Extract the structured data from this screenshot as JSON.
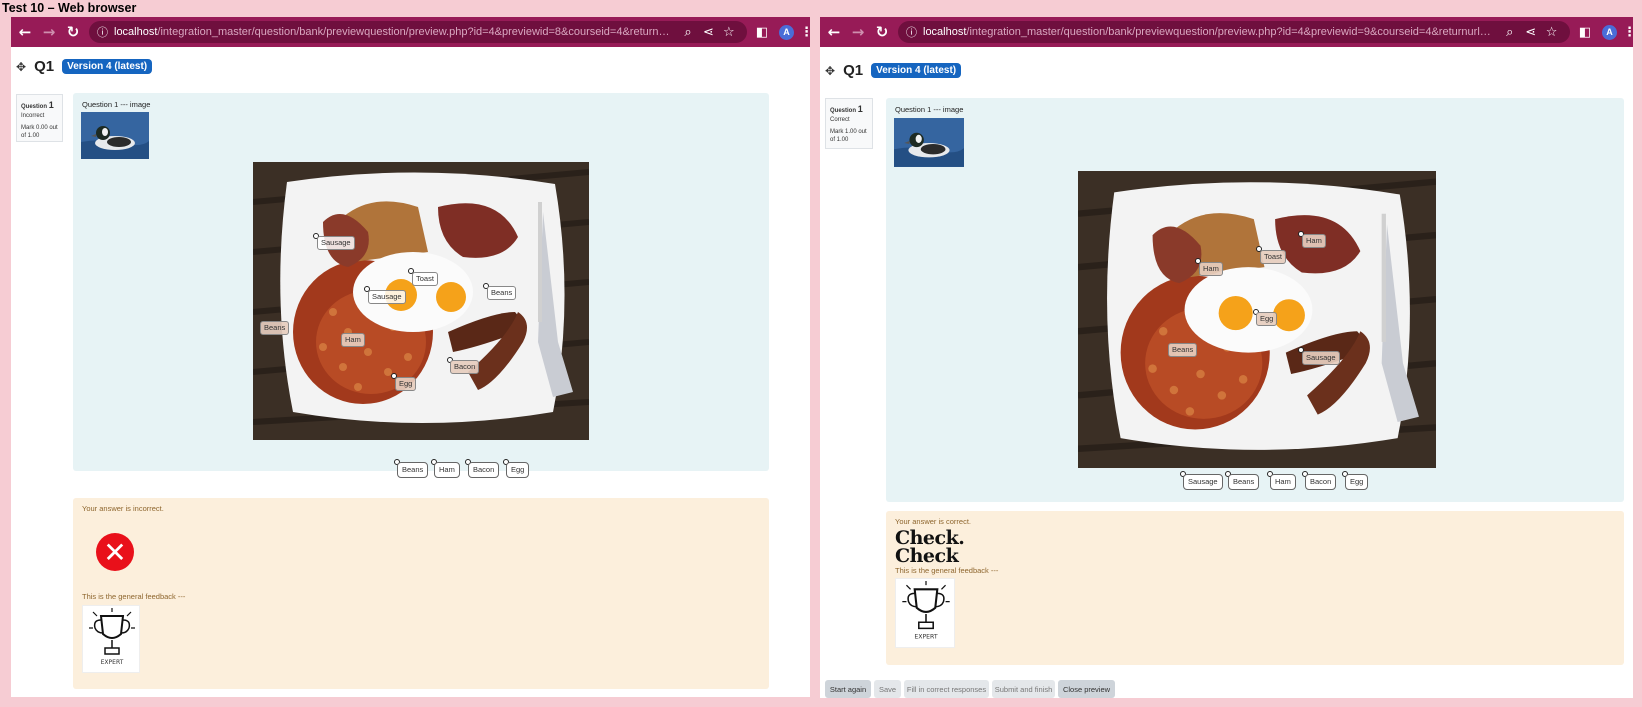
{
  "page_title": "Test 10 – Web browser",
  "left": {
    "url_host": "localhost",
    "url_path": "/integration_master/question/bank/previewquestion/preview.php?id=4&previewid=8&courseid=4&returnurl=http%...",
    "avatar": "A",
    "q_name": "Q1",
    "version": "Version 4 (latest)",
    "info_title": "Question",
    "info_num": "1",
    "info_status": "Incorrect",
    "info_mark": "Mark 0.00 out of 1.00",
    "qtext": "Question 1 --- image",
    "drops": {
      "d1": "Sausage",
      "d2": "Toast",
      "d3": "Sausage",
      "d4": "Beans",
      "d5": "Beans",
      "d6": "Ham",
      "d7": "Bacon",
      "d8": "Egg"
    },
    "chips": [
      "Beans",
      "Ham",
      "Bacon",
      "Egg"
    ],
    "feedback": "Your answer is incorrect.",
    "general_feedback": "This is the general feedback ---",
    "trophy_text": "EXPERT"
  },
  "right": {
    "url_host": "localhost",
    "url_path": "/integration_master/question/bank/previewquestion/preview.php?id=4&previewid=9&courseid=4&returnurl=http%...",
    "avatar": "A",
    "q_name": "Q1",
    "version": "Version 4 (latest)",
    "info_title": "Question",
    "info_num": "1",
    "info_status": "Correct",
    "info_mark": "Mark 1.00 out of 1.00",
    "qtext": "Question 1 --- image",
    "drops": {
      "d1": "Ham",
      "d2": "Toast",
      "d3": "Ham",
      "d4": "Egg",
      "d5": "Beans",
      "d6": "Sausage"
    },
    "chips": [
      "Sausage",
      "Beans",
      "Ham",
      "Bacon",
      "Egg"
    ],
    "feedback": "Your answer is correct.",
    "check_text": "Check. Check",
    "general_feedback": "This is the general feedback ---",
    "trophy_text": "EXPERT",
    "buttons": [
      "Start again",
      "Save",
      "Fill in correct responses",
      "Submit and finish",
      "Close preview"
    ]
  },
  "colors": {
    "toolbar": "#971b57",
    "badge": "#1565c0",
    "question_bg": "#e7f3f5",
    "feedback_bg": "#fcefdc",
    "x_red": "#e9101a",
    "page_bg": "#f6ccd3"
  }
}
